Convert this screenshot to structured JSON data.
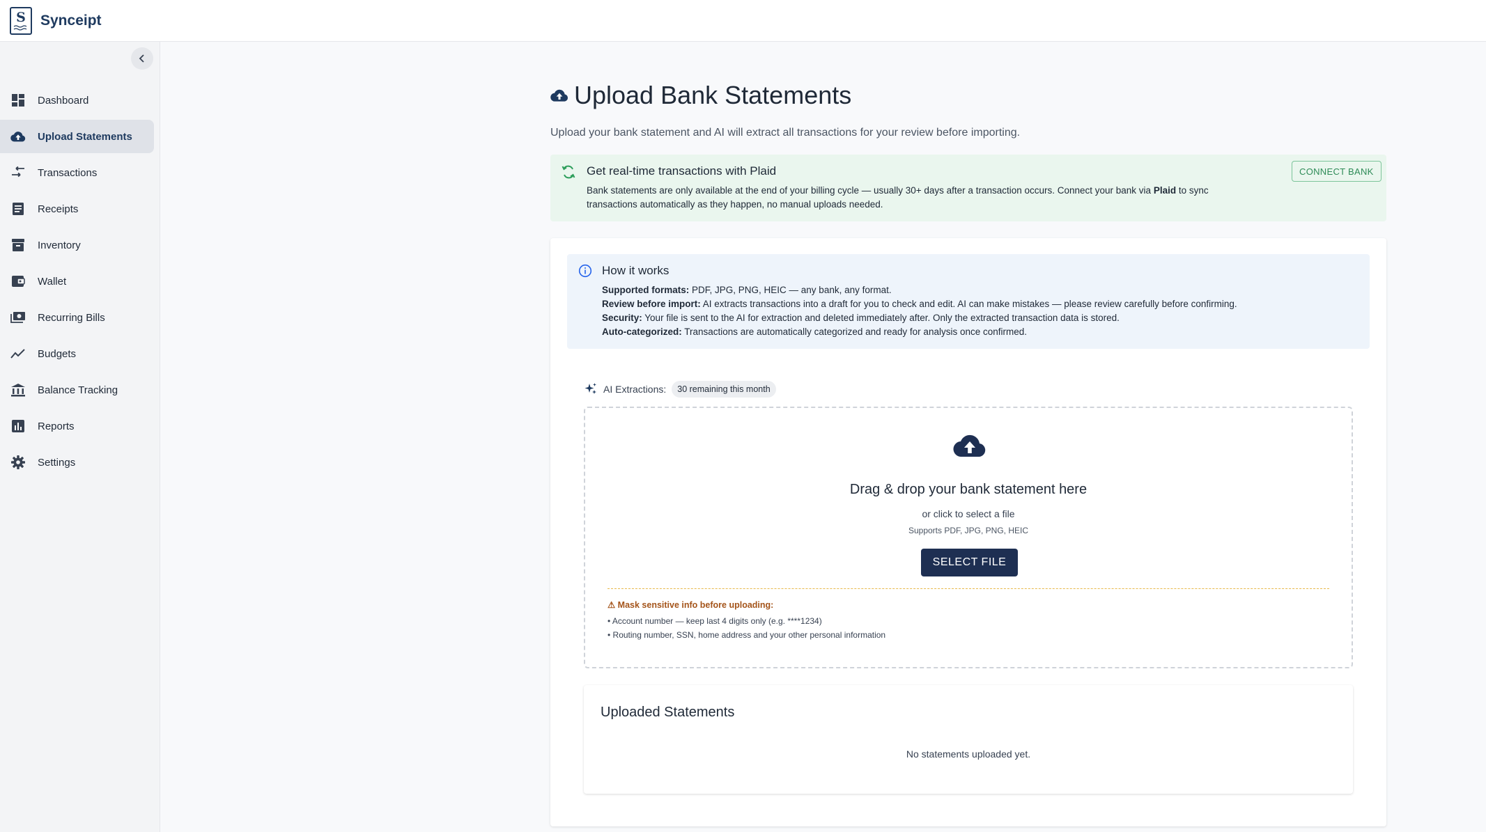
{
  "app": {
    "brand": "Synceipt",
    "logo_letter": "S"
  },
  "sidebar": {
    "items": [
      {
        "label": "Dashboard",
        "icon": "dashboard-icon"
      },
      {
        "label": "Upload Statements",
        "icon": "cloud-upload-icon",
        "active": true
      },
      {
        "label": "Transactions",
        "icon": "transactions-icon"
      },
      {
        "label": "Receipts",
        "icon": "receipt-icon"
      },
      {
        "label": "Inventory",
        "icon": "inventory-icon"
      },
      {
        "label": "Wallet",
        "icon": "wallet-icon"
      },
      {
        "label": "Recurring Bills",
        "icon": "bills-icon"
      },
      {
        "label": "Budgets",
        "icon": "trending-icon"
      },
      {
        "label": "Balance Tracking",
        "icon": "bank-icon"
      },
      {
        "label": "Reports",
        "icon": "bar-chart-icon"
      },
      {
        "label": "Settings",
        "icon": "gear-icon"
      }
    ]
  },
  "page": {
    "title": "Upload Bank Statements",
    "subtitle": "Upload your bank statement and AI will extract all transactions for your review before importing."
  },
  "plaid": {
    "title": "Get real-time transactions with Plaid",
    "body_before": "Bank statements are only available at the end of your billing cycle — usually 30+ days after a transaction occurs. Connect your bank via ",
    "body_bold": "Plaid",
    "body_after": " to sync transactions automatically as they happen, no manual uploads needed.",
    "button": "CONNECT BANK"
  },
  "how_it_works": {
    "title": "How it works",
    "lines": [
      {
        "label": "Supported formats:",
        "text": " PDF, JPG, PNG, HEIC — any bank, any format."
      },
      {
        "label": "Review before import:",
        "text": " AI extracts transactions into a draft for you to check and edit. AI can make mistakes — please review carefully before confirming."
      },
      {
        "label": "Security:",
        "text": " Your file is sent to the AI for extraction and deleted immediately after. Only the extracted transaction data is stored."
      },
      {
        "label": "Auto-categorized:",
        "text": " Transactions are automatically categorized and ready for analysis once confirmed."
      }
    ]
  },
  "ai_extractions": {
    "label": "AI Extractions:",
    "remaining": "30 remaining this month"
  },
  "dropzone": {
    "title": "Drag & drop your bank statement here",
    "subtitle": "or click to select a file",
    "formats": "Supports PDF, JPG, PNG, HEIC",
    "button": "SELECT FILE",
    "warning_title": "⚠ Mask sensitive info before uploading:",
    "warning_lines": [
      "• Account number — keep last 4 digits only (e.g. ****1234)",
      "• Routing number, SSN, home address and your other personal information"
    ]
  },
  "uploaded": {
    "title": "Uploaded Statements",
    "empty": "No statements uploaded yet."
  },
  "colors": {
    "primary": "#1e2f52",
    "plaid_bg": "#eaf6ee",
    "info_bg": "#eef4fb",
    "warning": "#a4541a"
  }
}
